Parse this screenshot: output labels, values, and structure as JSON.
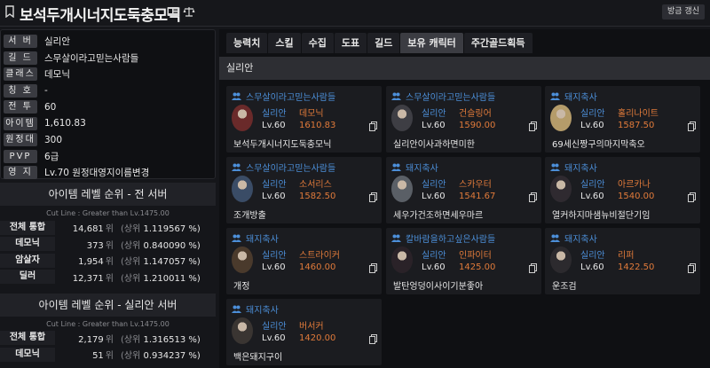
{
  "header": {
    "char_name": "보석두개시너지도둑충모닉",
    "refresh_label": "방금 갱신"
  },
  "profile": {
    "rows": [
      {
        "label": "서 버",
        "value": "실리안"
      },
      {
        "label": "길 드",
        "value": "스무살이라고믿는사람들"
      },
      {
        "label": "클래스",
        "value": "데모닉"
      },
      {
        "label": "칭 호",
        "value": "-"
      },
      {
        "label": "전 투",
        "value": "60"
      },
      {
        "label": "아이템",
        "value": "1,610.83"
      },
      {
        "label": "원정대",
        "value": "300"
      },
      {
        "label": "PVP",
        "value": "6급"
      },
      {
        "label": "영 지",
        "value": "Lv.70 원정대영지이름변경"
      }
    ]
  },
  "rank_all": {
    "title": "아이템 레벨 순위 - 전 서버",
    "cutline": "Cut Line : Greater than Lv.1475.00",
    "rows": [
      {
        "name": "전체 통합",
        "rank": "14,681",
        "unit": "위",
        "pct": "1.119567 %)",
        "pre": "(상위"
      },
      {
        "name": "데모닉",
        "rank": "373",
        "unit": "위",
        "pct": "0.840090 %)",
        "pre": "(상위"
      },
      {
        "name": "암살자",
        "rank": "1,954",
        "unit": "위",
        "pct": "1.147057 %)",
        "pre": "(상위"
      },
      {
        "name": "딜러",
        "rank": "12,371",
        "unit": "위",
        "pct": "1.210011 %)",
        "pre": "(상위"
      }
    ]
  },
  "rank_server": {
    "title": "아이템 레벨 순위 - 실리안 서버",
    "cutline": "Cut Line : Greater than Lv.1475.00",
    "rows": [
      {
        "name": "전체 통합",
        "rank": "2,179",
        "unit": "위",
        "pct": "1.316513 %)",
        "pre": "(상위"
      },
      {
        "name": "데모닉",
        "rank": "51",
        "unit": "위",
        "pct": "0.934237 %)",
        "pre": "(상위"
      }
    ]
  },
  "tabs": [
    "능력치",
    "스킬",
    "수집",
    "도표",
    "길드",
    "보유 캐릭터",
    "주간골드획득"
  ],
  "server_bar": "실리안",
  "characters": [
    {
      "guild": "스무살이라고믿는사람들",
      "server": "실리안",
      "cls": "데모닉",
      "lv": "Lv.60",
      "ilvl": "1610.83",
      "nick": "보석두개시너지도둑충모닉",
      "portrait": "#6a2a2a"
    },
    {
      "guild": "스무살이라고믿는사람들",
      "server": "실리안",
      "cls": "건슬링어",
      "lv": "Lv.60",
      "ilvl": "1590.00",
      "nick": "실리안이사과하면미한",
      "portrait": "#3e3e44"
    },
    {
      "guild": "돼지축사",
      "server": "실리안",
      "cls": "홀리나이트",
      "lv": "Lv.60",
      "ilvl": "1587.50",
      "nick": "69세신짱구의마지막축오",
      "portrait": "#b59c6a"
    },
    {
      "guild": "스무살이라고믿는사람들",
      "server": "실리안",
      "cls": "소서리스",
      "lv": "Lv.60",
      "ilvl": "1582.50",
      "nick": "조개방출",
      "portrait": "#3a4c66"
    },
    {
      "guild": "돼지축사",
      "server": "실리안",
      "cls": "스카우터",
      "lv": "Lv.60",
      "ilvl": "1541.67",
      "nick": "세우가건조하면세우마르",
      "portrait": "#5a5f66"
    },
    {
      "guild": "돼지축사",
      "server": "실리안",
      "cls": "아르카나",
      "lv": "Lv.60",
      "ilvl": "1540.00",
      "nick": "열커하지마샘뉴비절단기임",
      "portrait": "#2f2a30"
    },
    {
      "guild": "돼지축사",
      "server": "실리안",
      "cls": "스트라이커",
      "lv": "Lv.60",
      "ilvl": "1460.00",
      "nick": "개정",
      "portrait": "#4a3a2c"
    },
    {
      "guild": "칼바람을하고싶은사람들",
      "server": "실리안",
      "cls": "인파이터",
      "lv": "Lv.60",
      "ilvl": "1425.00",
      "nick": "발탄엉덩이사이기분좋아",
      "portrait": "#2a2228"
    },
    {
      "guild": "돼지축사",
      "server": "실리안",
      "cls": "리퍼",
      "lv": "Lv.60",
      "ilvl": "1422.50",
      "nick": "운조검",
      "portrait": "#2c2a2e"
    },
    {
      "guild": "돼지축사",
      "server": "실리안",
      "cls": "버서커",
      "lv": "Lv.60",
      "ilvl": "1420.00",
      "nick": "백은돼지구이",
      "portrait": "#3a3532"
    }
  ],
  "icons": {
    "bookmark": "bookmark-icon",
    "card": "id-card-icon",
    "scale": "scale-icon",
    "people": "people-icon",
    "copy": "copy-icon"
  },
  "colors": {
    "accent_blue": "#4c8fd9",
    "accent_orange": "#e07a3a",
    "bg": "#15161a"
  }
}
